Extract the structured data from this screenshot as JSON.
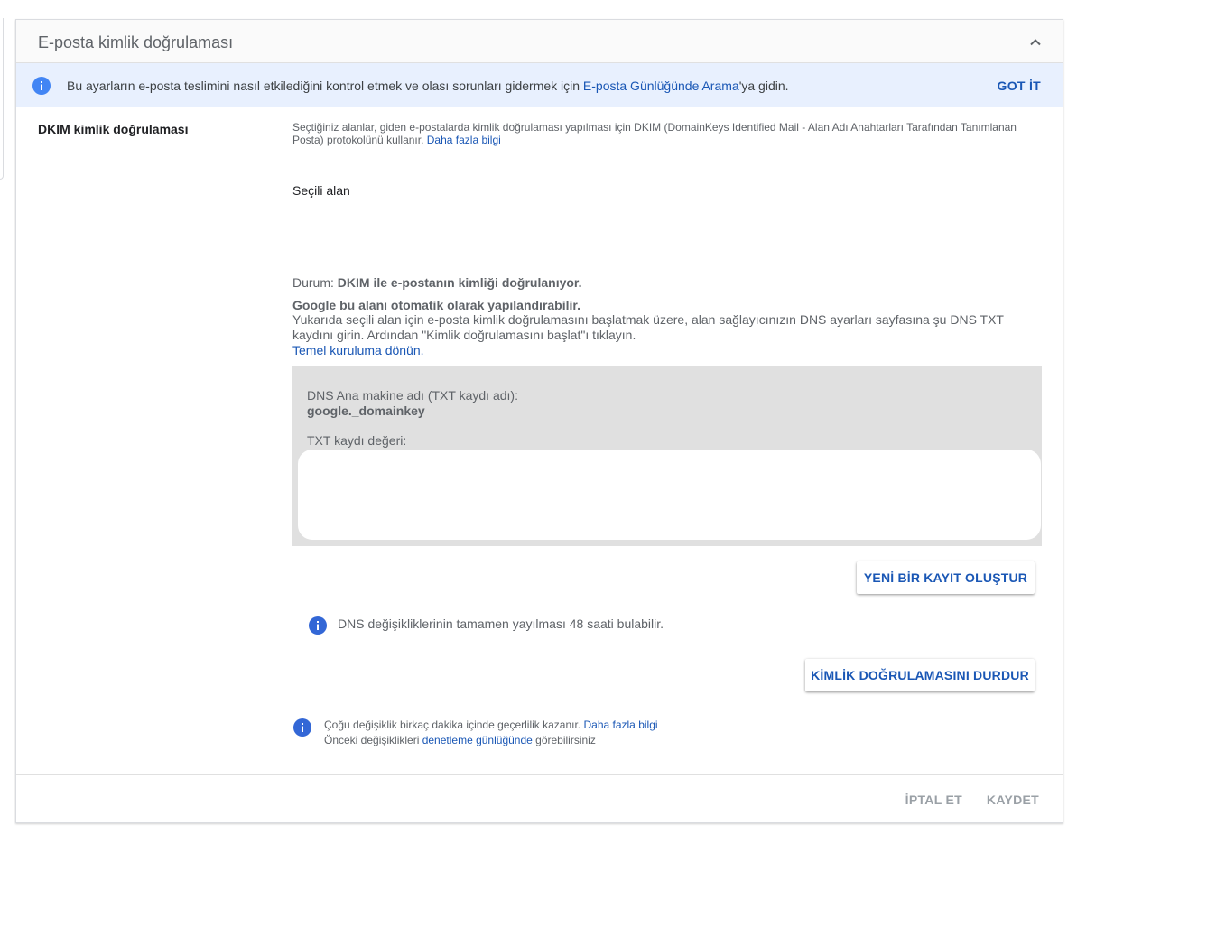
{
  "header": {
    "title": "E-posta kimlik doğrulaması"
  },
  "banner": {
    "text_before": "Bu ayarların e-posta teslimini nasıl etkilediğini kontrol etmek ve olası sorunları gidermek için ",
    "link": "E-posta Günlüğünde Arama",
    "text_after": "'ya gidin.",
    "dismiss": "GOT İT"
  },
  "section": {
    "label": "DKIM kimlik doğrulaması",
    "description": "Seçtiğiniz alanlar, giden e-postalarda kimlik doğrulaması yapılması için DKIM (DomainKeys Identified Mail - Alan Adı Anahtarları Tarafından Tanımlanan Posta) protokolünü kullanır.",
    "learn_more": "Daha fazla bilgi",
    "selected_domain_label": "Seçili alan",
    "status_label": "Durum:",
    "status_value": "DKIM ile e-postanın kimliği doğrulanıyor.",
    "auto_config": "Google bu alanı otomatik olarak yapılandırabilir.",
    "instructions": "Yukarıda seçili alan için e-posta kimlik doğrulamasını başlatmak üzere, alan sağlayıcınızın DNS ayarları sayfasına şu DNS TXT kaydını girin. Ardından \"Kimlik doğrulamasını başlat\"ı tıklayın.",
    "back_link": "Temel kuruluma dönün."
  },
  "dns": {
    "host_label": "DNS Ana makine adı (TXT kaydı adı):",
    "host_value": "google._domainkey",
    "txt_label": "TXT kaydı değeri:",
    "txt_value": ""
  },
  "buttons": {
    "new_record": "YENİ BİR KAYIT OLUŞTUR",
    "stop_auth": "KİMLİK DOĞRULAMASINI DURDUR",
    "cancel": "İPTAL ET",
    "save": "KAYDET"
  },
  "notes": {
    "dns_propagation": "DNS değişikliklerinin tamamen yayılması 48 saati bulabilir.",
    "changes_text": "Çoğu değişiklik birkaç dakika içinde geçerlilik kazanır.",
    "changes_link": "Daha fazla bilgi",
    "audit_before": "Önceki değişiklikleri ",
    "audit_link": "denetleme günlüğünde",
    "audit_after": " görebilirsiniz"
  },
  "colors": {
    "accent": "#1a57b5",
    "banner_bg": "#e8f0fe",
    "dns_box_bg": "#e0e0e0",
    "info_icon": "#4285f4"
  }
}
